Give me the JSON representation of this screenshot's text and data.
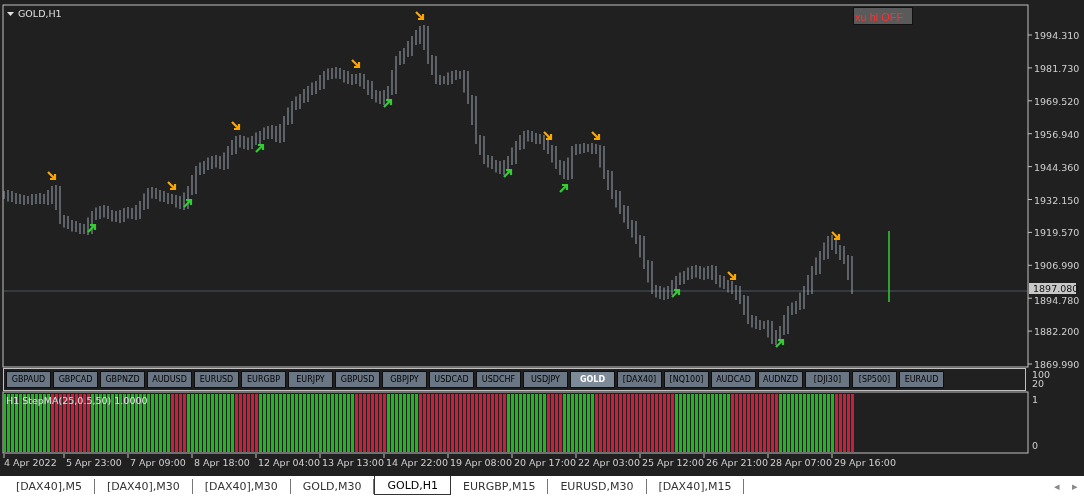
{
  "chart": {
    "symbol_label": "GOLD,H1",
    "toggle_button": "xu hl OFF",
    "price_scale": [
      "1994.310",
      "1981.730",
      "1969.520",
      "1956.940",
      "1944.360",
      "1932.150",
      "1919.570",
      "1906.990",
      "1894.780",
      "1882.200",
      "1869.990"
    ],
    "current_price": "1897.080",
    "time_scale": [
      "4 Apr 2022",
      "5 Apr 23:00",
      "7 Apr 09:00",
      "8 Apr 18:00",
      "12 Apr 04:00",
      "13 Apr 13:00",
      "14 Apr 22:00",
      "19 Apr 08:00",
      "20 Apr 17:00",
      "22 Apr 03:00",
      "25 Apr 12:00",
      "26 Apr 21:00",
      "28 Apr 07:00",
      "29 Apr 16:00"
    ]
  },
  "symbol_buttons": [
    {
      "label": "GBPAUD",
      "selected": false
    },
    {
      "label": "GBPCAD",
      "selected": false
    },
    {
      "label": "GBPNZD",
      "selected": false
    },
    {
      "label": "AUDUSD",
      "selected": false
    },
    {
      "label": "EURUSD",
      "selected": false
    },
    {
      "label": "EURGBP",
      "selected": false
    },
    {
      "label": "EURJPY",
      "selected": false
    },
    {
      "label": "GBPUSD",
      "selected": false
    },
    {
      "label": "GBPJPY",
      "selected": false
    },
    {
      "label": "USDCAD",
      "selected": false
    },
    {
      "label": "USDCHF",
      "selected": false
    },
    {
      "label": "USDJPY",
      "selected": false
    },
    {
      "label": "GOLD",
      "selected": true
    },
    {
      "label": "[DAX40]",
      "selected": false
    },
    {
      "label": "[NQ100]",
      "selected": false
    },
    {
      "label": "AUDCAD",
      "selected": false
    },
    {
      "label": "AUDNZD",
      "selected": false
    },
    {
      "label": "[DJI30]",
      "selected": false
    },
    {
      "label": "[SP500]",
      "selected": false
    },
    {
      "label": "EURAUD",
      "selected": false
    }
  ],
  "button_panel_scale": [
    "100",
    "20"
  ],
  "indicator": {
    "label": "H1 StepMA(25,0.5,50) 1.0000",
    "scale": [
      "1",
      "0"
    ]
  },
  "tabs": [
    {
      "label": "[DAX40],M5",
      "selected": false
    },
    {
      "label": "[DAX40],M30",
      "selected": false
    },
    {
      "label": "[DAX40],M30",
      "selected": false
    },
    {
      "label": "GOLD,M30",
      "selected": false
    },
    {
      "label": "GOLD,H1",
      "selected": true
    },
    {
      "label": "EURGBP,M15",
      "selected": false
    },
    {
      "label": "EURUSD,M30",
      "selected": false
    },
    {
      "label": "[DAX40],M15",
      "selected": false
    }
  ],
  "tab_scroll": [
    "◂",
    "▸"
  ]
}
